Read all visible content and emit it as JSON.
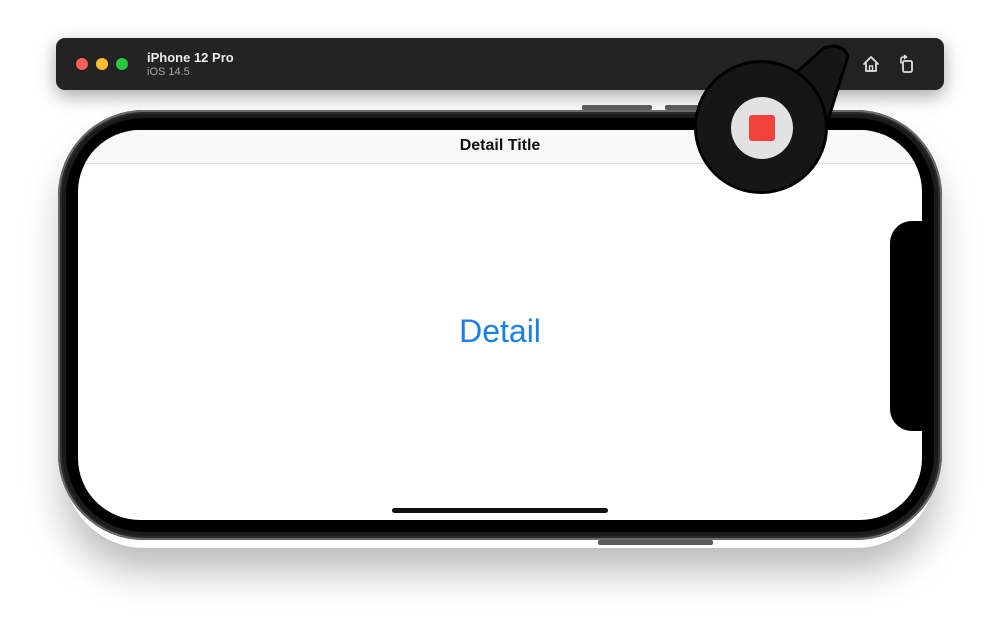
{
  "toolbar": {
    "device_name": "iPhone 12 Pro",
    "os_version": "iOS 14.5",
    "icons": {
      "record": "record-icon",
      "home": "home-icon",
      "rotate": "rotate-icon"
    }
  },
  "screen": {
    "nav_title": "Detail Title",
    "body_link": "Detail"
  },
  "colors": {
    "link_blue": "#1a7fe8",
    "record_red": "#f0423b",
    "toolbar_bg": "#232323",
    "traffic_red": "#fe5f57",
    "traffic_yellow": "#febc2e",
    "traffic_green": "#28c840"
  }
}
